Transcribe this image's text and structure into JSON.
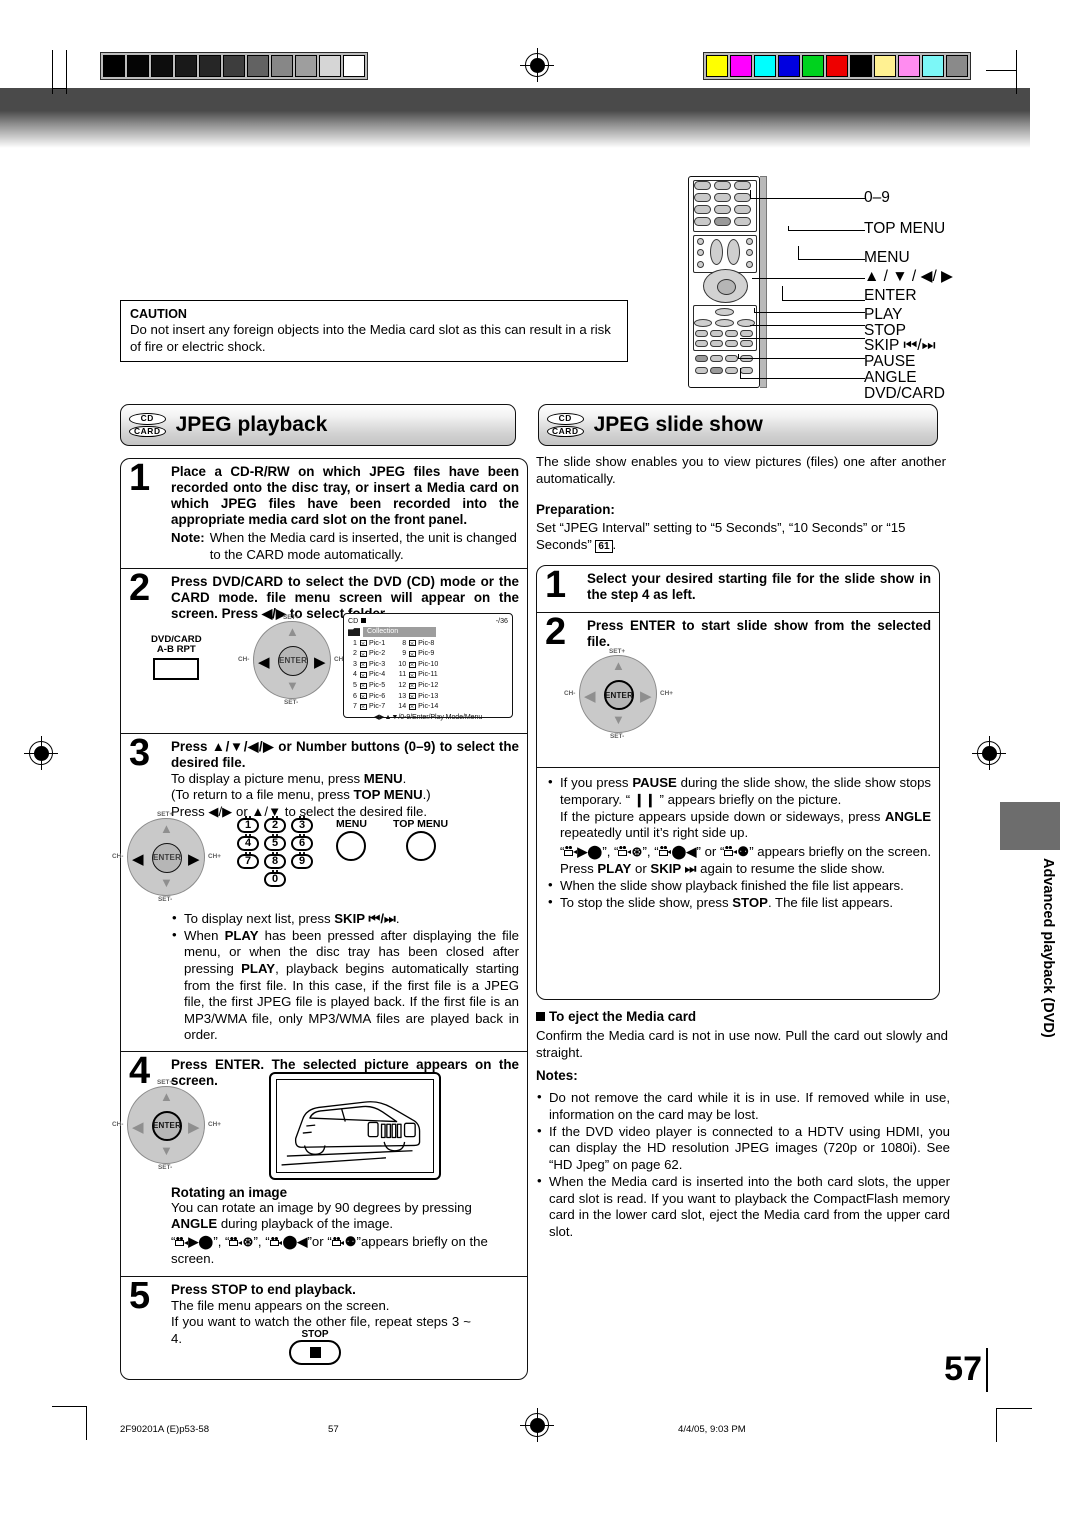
{
  "document": {
    "page_number": "57",
    "side_tab": "Advanced playback (DVD)",
    "footer": {
      "doc_code": "2F90201A (E)p53-58",
      "page": "57",
      "timestamp": "4/4/05, 9:03 PM"
    }
  },
  "calibration": {
    "gray_swatches": [
      "#000000",
      "#050505",
      "#0d0d0d",
      "#191919",
      "#262626",
      "#3d3d3d",
      "#626262",
      "#878787",
      "#9e9e9e",
      "#d6d6d6",
      "#ffffff"
    ],
    "color_swatches": [
      "#ffff00",
      "#ff00ff",
      "#00ffff",
      "#0000e0",
      "#00d21e",
      "#ee0000",
      "#000000",
      "#fff192",
      "#ff8cf0",
      "#7cf7f7",
      "#8a8a8a"
    ]
  },
  "remote_diagram": {
    "labels": [
      "0–9",
      "TOP MENU",
      "MENU",
      "▲ / ▼ / ◀/ ▶",
      "ENTER",
      "PLAY",
      "STOP",
      "SKIP ⏮/⏭",
      "PAUSE",
      "ANGLE",
      "DVD/CARD"
    ]
  },
  "caution": {
    "title": "CAUTION",
    "body": "Do not insert any foreign objects into the Media card slot as this can result in a risk of fire or electric shock."
  },
  "left_section": {
    "badges": [
      "CD",
      "CARD"
    ],
    "title": "JPEG playback",
    "steps": [
      {
        "num": "1",
        "head": "Place a CD-R/RW on which JPEG files have been recorded onto the disc tray, or insert a Media card on which JPEG files have been recorded into the appropriate media card slot on the front panel.",
        "note_key": "Note:",
        "note_val": "When the Media card is inserted, the unit is changed to the CARD mode automatically."
      },
      {
        "num": "2",
        "head": "Press DVD/CARD to select the DVD (CD) mode or the CARD mode. file menu screen will appear on the screen. Press ◀/▶ to select folder."
      },
      {
        "num": "3",
        "head": "Press ▲/▼/◀/▶ or Number buttons (0–9) to select the desired file.",
        "body_lines": [
          "To display a picture menu, press MENU.",
          "(To return to a file menu, press TOP MENU.)",
          "Press ◀/▶ or ▲/▼ to select the desired file."
        ],
        "bullets": [
          "To display next list, press SKIP ⏮/⏭.",
          "When PLAY has been pressed after displaying the file menu, or when the disc tray has been closed after pressing PLAY, playback begins automatically starting from the first file. In this case, if the first file is a JPEG file, the first JPEG file is played back. If the first file is an MP3/WMA file, only MP3/WMA files are played back in order."
        ]
      },
      {
        "num": "4",
        "head": "Press ENTER. The selected picture appears on the screen.",
        "sub_title": "Rotating an image",
        "sub_body": "You can rotate an image by 90 degrees by pressing ANGLE during playback of the image.",
        "sub_glyph_tail": "appears briefly on the screen."
      },
      {
        "num": "5",
        "head": "Press STOP to end playback.",
        "body_lines": [
          "The file menu appears on the screen.",
          "If you want to watch the other file, repeat steps 3 ~ 4."
        ]
      }
    ],
    "dvdcard_button": {
      "line1": "DVD/CARD",
      "line2": "A-B RPT"
    },
    "pad": {
      "enter": "ENTER",
      "top": "SET+",
      "bottom": "SET-",
      "left": "CH-",
      "right": "CH+"
    },
    "numpad_keys": [
      "1",
      "2",
      "3",
      "4",
      "5",
      "6",
      "7",
      "8",
      "9",
      "0"
    ],
    "menu_button": "MENU",
    "top_menu_button": "TOP MENU",
    "stop_button": "STOP"
  },
  "osd_screen": {
    "mode": "CD",
    "counter": "-/36",
    "folder": "Collection",
    "files_left": [
      {
        "idx": "1",
        "name": "Pic-1"
      },
      {
        "idx": "2",
        "name": "Pic-2"
      },
      {
        "idx": "3",
        "name": "Pic-3"
      },
      {
        "idx": "4",
        "name": "Pic-4"
      },
      {
        "idx": "5",
        "name": "Pic-5"
      },
      {
        "idx": "6",
        "name": "Pic-6"
      },
      {
        "idx": "7",
        "name": "Pic-7"
      }
    ],
    "files_right": [
      {
        "idx": "8",
        "name": "Pic-8"
      },
      {
        "idx": "9",
        "name": "Pic-9"
      },
      {
        "idx": "10",
        "name": "Pic-10"
      },
      {
        "idx": "11",
        "name": "Pic-11"
      },
      {
        "idx": "12",
        "name": "Pic-12"
      },
      {
        "idx": "13",
        "name": "Pic-13"
      },
      {
        "idx": "14",
        "name": "Pic-14"
      }
    ],
    "footbar": "◀▶▲▼/0-9/Enter/Play Mode/Menu"
  },
  "right_section": {
    "badges": [
      "CD",
      "CARD"
    ],
    "title": "JPEG slide show",
    "intro": "The slide show enables you to view pictures (files) one after another automatically.",
    "prep_title": "Preparation:",
    "prep_body_a": "Set “JPEG Interval” setting to “5 Seconds”, “10 Seconds” or “15 Seconds”",
    "prep_page_ref": "61",
    "steps": [
      {
        "num": "1",
        "head": "Select your desired starting file for the slide show in the step 4 as left."
      },
      {
        "num": "2",
        "head": "Press ENTER to start slide show from the selected file."
      }
    ],
    "pad": {
      "enter": "ENTER",
      "top": "SET+",
      "bottom": "SET-",
      "left": "CH-",
      "right": "CH+"
    },
    "bullets": {
      "pause_a": "If you press PAUSE during the slide show, the slide show stops temporary. “ ❙❙ ” appears briefly on the picture.",
      "pause_b": "If the picture appears upside down or sideways, press ANGLE repeatedly until it’s right side up.",
      "pause_c_tail": "appears briefly on the screen.",
      "pause_d": "Press PLAY or SKIP ⏭ again to resume the slide show.",
      "finished": "When the slide show playback finished the file list appears.",
      "stop": "To stop the slide show, press STOP. The file list appears."
    },
    "eject": {
      "heading": "To eject the Media card",
      "body": "Confirm the Media card is not in use now. Pull the card out slowly and straight.",
      "notes_title": "Notes:",
      "notes": [
        "Do not remove the card while it is in use. If removed while in use, information on the card may be lost.",
        "If the DVD video player is connected to a HDTV using HDMI, you can display the HD resolution JPEG images (720p or 1080i). See “HD Jpeg” on page 62.",
        "When the Media card is inserted into the both card slots, the upper card slot is read. If you want to playback the CompactFlash memory card in the lower card slot, eject the Media card from the upper card slot."
      ]
    }
  }
}
